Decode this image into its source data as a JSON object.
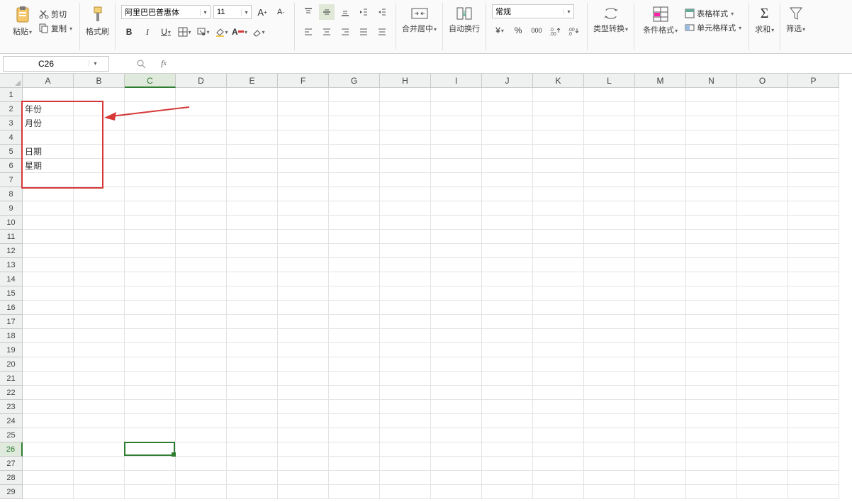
{
  "ribbon": {
    "paste_label": "粘贴",
    "cut_label": "剪切",
    "copy_label": "复制",
    "format_painter_label": "格式刷",
    "font_name": "阿里巴巴普惠体",
    "font_size": "11",
    "merge_center_label": "合并居中",
    "auto_wrap_label": "自动换行",
    "number_format": "常规",
    "type_convert_label": "类型转换",
    "conditional_format_label": "条件格式",
    "table_style_label": "表格样式",
    "cell_style_label": "单元格样式",
    "sum_label": "求和",
    "filter_label": "筛选"
  },
  "formula_bar": {
    "cell_reference": "C26",
    "formula": ""
  },
  "columns": [
    "A",
    "B",
    "C",
    "D",
    "E",
    "F",
    "G",
    "H",
    "I",
    "J",
    "K",
    "L",
    "M",
    "N",
    "O",
    "P"
  ],
  "row_count": 29,
  "selected_col_index": 2,
  "selected_row_index": 25,
  "cells": {
    "A2": "年份",
    "A3": "月份",
    "A5": "日期",
    "A6": "星期"
  },
  "active_cell": {
    "col": 2,
    "row": 25
  },
  "annotation": {
    "box": {
      "row_start": 2,
      "row_end": 7,
      "col_start": 0,
      "col_end": 1
    }
  }
}
